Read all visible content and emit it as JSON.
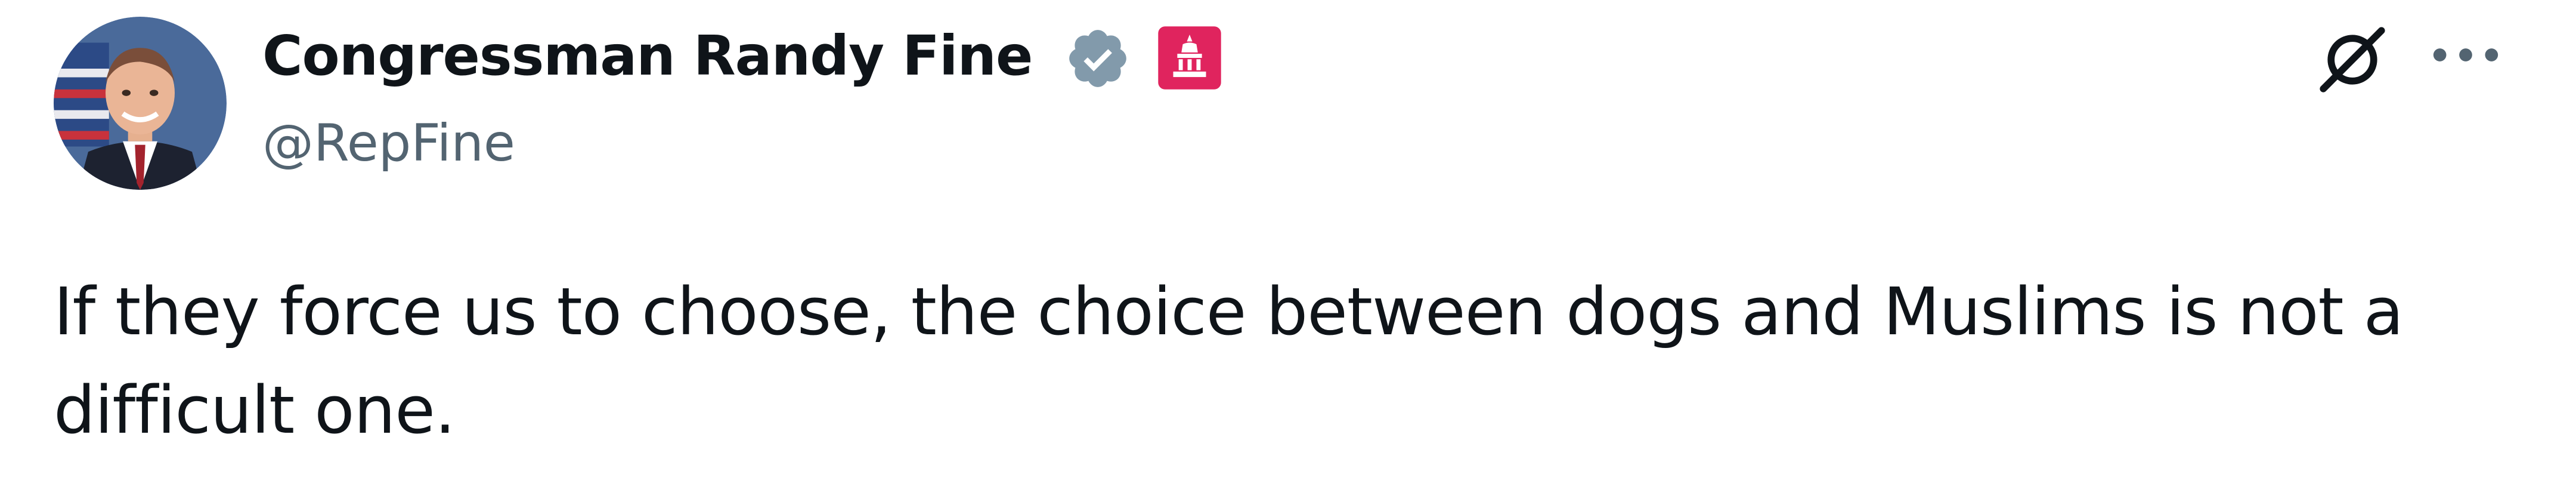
{
  "author": {
    "display_name": "Congressman Randy Fine",
    "handle": "@RepFine",
    "avatar": "avatar-photo",
    "verified_icon": "verified-badge-icon",
    "affiliation_icon": "government-affiliation-icon"
  },
  "tweet": {
    "text": "If they force us to choose, the choice between dogs and Muslims is not a difficult one."
  },
  "actions": {
    "grok_icon": "grok-icon",
    "more_icon": "more-options-icon"
  },
  "colors": {
    "text": "#0f1419",
    "secondary_text": "#536471",
    "verified_badge": "#829aab",
    "affiliation_badge": "#e0245e"
  }
}
